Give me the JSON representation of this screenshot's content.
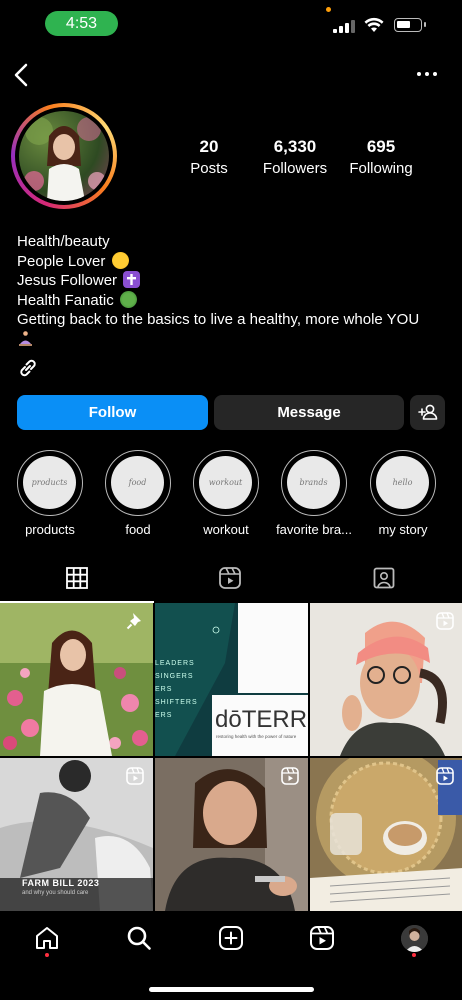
{
  "status_bar": {
    "time": "4:53"
  },
  "profile": {
    "posts_count": "20",
    "posts_label": "Posts",
    "followers_count": "6,330",
    "followers_label": "Followers",
    "following_count": "695",
    "following_label": "Following",
    "bio": {
      "line1": "Health/beauty",
      "line2": "People Lover",
      "line3": "Jesus Follower",
      "line4": "Health Fanatic",
      "line5": "Getting back to the basics to live a healthy, more whole YOU"
    }
  },
  "actions": {
    "follow_label": "Follow",
    "message_label": "Message"
  },
  "highlights": [
    {
      "label": "products",
      "cover_text": "products"
    },
    {
      "label": "food",
      "cover_text": "food"
    },
    {
      "label": "workout",
      "cover_text": "workout"
    },
    {
      "label": "favorite bra...",
      "cover_text": "brands"
    },
    {
      "label": "my story",
      "cover_text": "hello"
    }
  ],
  "grid": {
    "post2_side_text": [
      "LEADERS",
      "SINGERS",
      "ERS",
      "SHIFTERS",
      "ERS"
    ],
    "post2_brand": "dōTERR",
    "post2_brand_sub": "restoring health with the power of nature",
    "post4_caption": "FARM BILL 2023",
    "post4_sub": "and why you should care"
  },
  "icons": {
    "back": "chevron-left-icon",
    "more": "more-horizontal-icon",
    "link": "link-icon",
    "add_user": "add-user-icon",
    "grid_tab": "grid-icon",
    "reels_tab": "reels-icon",
    "tagged_tab": "tagged-icon",
    "home": "home-icon",
    "search": "search-icon",
    "create": "create-icon",
    "reels": "reels-icon",
    "profile": "avatar"
  },
  "colors": {
    "follow": "#0a8ff6",
    "secondary_button": "#262626",
    "time_pill": "#2fb350",
    "notification_dot": "#ff3040"
  }
}
